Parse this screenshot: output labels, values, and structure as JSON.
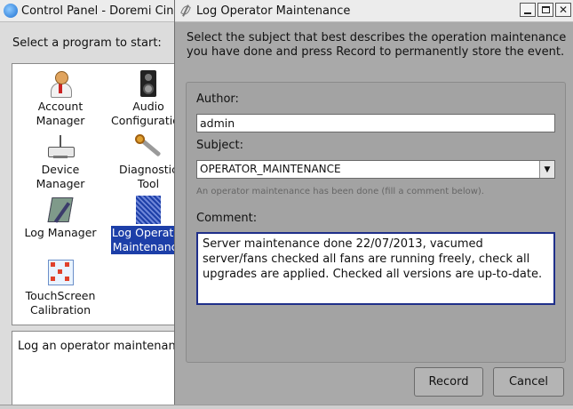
{
  "control_panel": {
    "title": "Control Panel - Doremi Cinema",
    "prompt": "Select a program to start:",
    "programs": [
      {
        "label": "Account\nManager",
        "icon": "account-manager-icon"
      },
      {
        "label": "Audio\nConfiguration",
        "icon": "audio-configuration-icon"
      },
      {
        "label": "Device\nManager",
        "icon": "device-manager-icon"
      },
      {
        "label": "Diagnostic\nTool",
        "icon": "diagnostic-tool-icon"
      },
      {
        "label": "Log Manager",
        "icon": "log-manager-icon"
      },
      {
        "label": "Log Operator\nMaintenance",
        "icon": "log-operator-maintenance-icon",
        "selected": true
      },
      {
        "label": "TouchScreen\nCalibration",
        "icon": "touchscreen-calibration-icon"
      }
    ],
    "description": "Log an operator maintenance"
  },
  "dialog": {
    "title": "Log Operator Maintenance",
    "instructions": "Select the subject that best describes the operation maintenance you have done and press Record to permanently store the event.",
    "author_label": "Author:",
    "author_value": "admin",
    "subject_label": "Subject:",
    "subject_value": "OPERATOR_MAINTENANCE",
    "subject_hint": "An operator maintenance has been done (fill a comment below).",
    "comment_label": "Comment:",
    "comment_value": "Server maintenance done 22/07/2013, vacumed server/fans checked all fans are running freely, check all upgrades are applied. Checked all versions are up-to-date.",
    "record_label": "Record",
    "cancel_label": "Cancel",
    "window_buttons": {
      "minimize": "minimize-icon",
      "maximize": "maximize-icon",
      "close": "close-icon"
    }
  },
  "colors": {
    "selection": "#1d3fa8",
    "dialog_bg": "#a9a9a9",
    "comment_border": "#1f2f8a"
  }
}
